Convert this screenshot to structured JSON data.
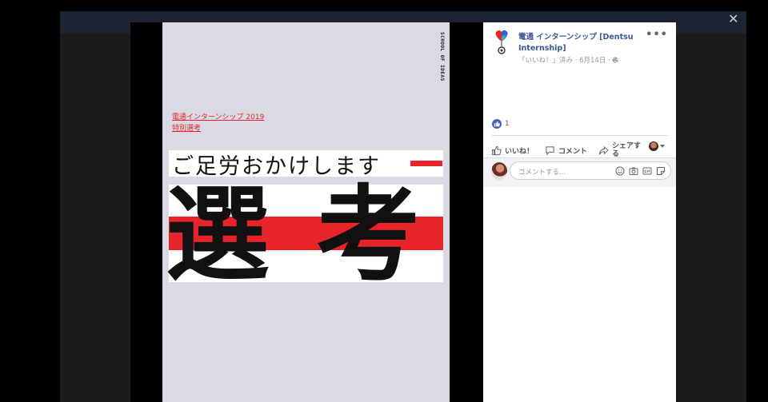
{
  "poster": {
    "side_text": "SCHOOL OF IDEAS",
    "title_line1": "電通インターンシップ 2019",
    "title_line2": "特別選考",
    "tagline": "ご足労おかけします",
    "kanji1": "選",
    "kanji2": "考",
    "accent_color": "#e8242b"
  },
  "post": {
    "page_name": "電通 インターンシップ [Dentsu Internship]",
    "meta": "「いいね！」済み · 6月14日 ·",
    "more_label": "•••",
    "reaction_count": "1",
    "actions": {
      "like": "いいね！",
      "comment": "コメント",
      "share": "シェアする"
    },
    "comment_placeholder": "コメントする..."
  },
  "viewer": {
    "close_glyph": "✕"
  }
}
